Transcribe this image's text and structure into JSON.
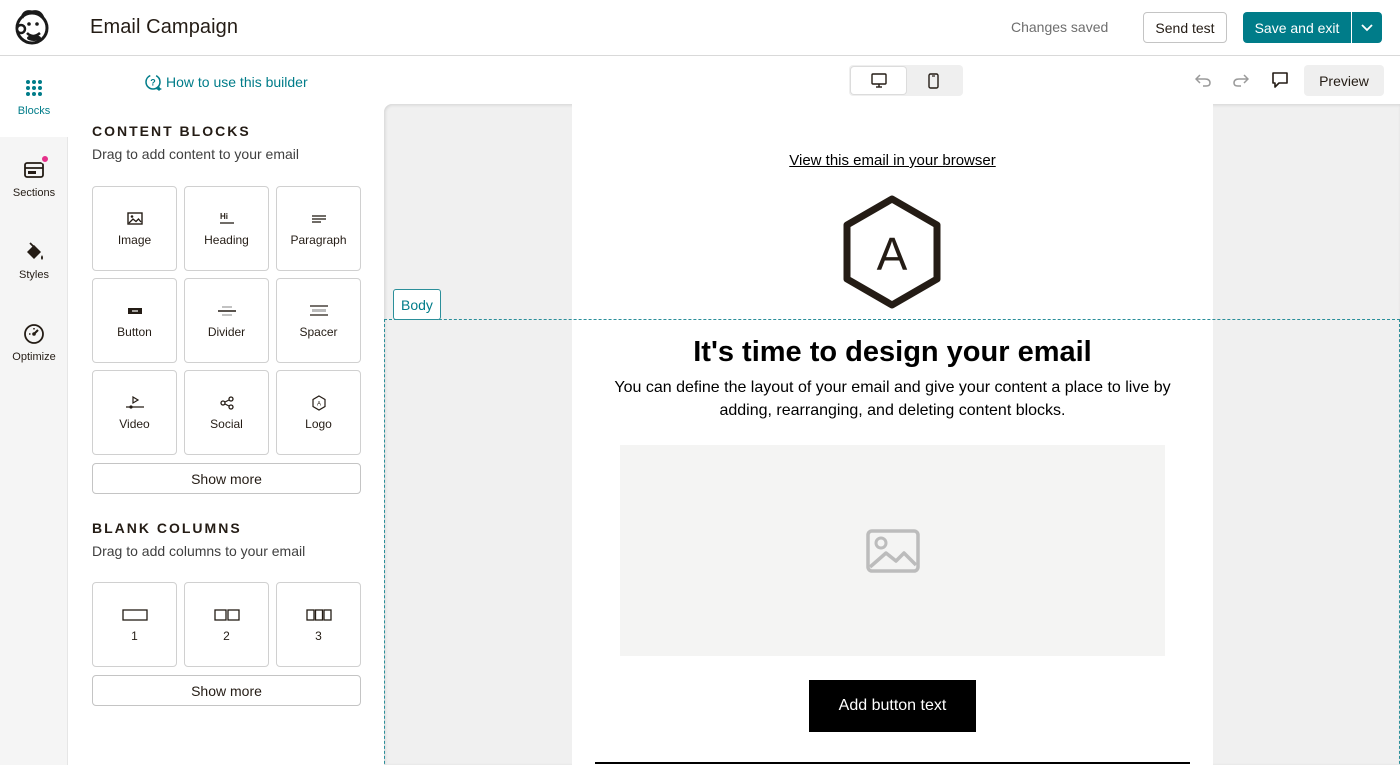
{
  "header": {
    "title": "Email Campaign",
    "status": "Changes saved",
    "send_test_label": "Send test",
    "save_exit_label": "Save and exit"
  },
  "rail": {
    "items": [
      {
        "label": "Blocks",
        "icon": "blocks-grid-icon",
        "active": true
      },
      {
        "label": "Sections",
        "icon": "sections-icon",
        "badge": true
      },
      {
        "label": "Styles",
        "icon": "paint-bucket-icon"
      },
      {
        "label": "Optimize",
        "icon": "gauge-icon"
      }
    ]
  },
  "panel": {
    "howto_label": "How to use this builder",
    "content_blocks": {
      "title": "CONTENT BLOCKS",
      "subtitle": "Drag to add content to your email",
      "items": [
        {
          "label": "Image",
          "icon": "image-icon"
        },
        {
          "label": "Heading",
          "icon": "heading-icon"
        },
        {
          "label": "Paragraph",
          "icon": "paragraph-icon"
        },
        {
          "label": "Button",
          "icon": "button-icon"
        },
        {
          "label": "Divider",
          "icon": "divider-icon"
        },
        {
          "label": "Spacer",
          "icon": "spacer-icon"
        },
        {
          "label": "Video",
          "icon": "video-icon"
        },
        {
          "label": "Social",
          "icon": "social-share-icon"
        },
        {
          "label": "Logo",
          "icon": "logo-hexagon-icon"
        }
      ],
      "show_more_label": "Show more"
    },
    "blank_columns": {
      "title": "BLANK COLUMNS",
      "subtitle": "Drag to add columns to your email",
      "items": [
        {
          "label": "1",
          "icon": "one-column-icon"
        },
        {
          "label": "2",
          "icon": "two-column-icon"
        },
        {
          "label": "3",
          "icon": "three-column-icon"
        }
      ],
      "show_more_label": "Show more"
    }
  },
  "toolbar": {
    "views": [
      "desktop-icon",
      "mobile-icon"
    ],
    "active_view": "desktop",
    "preview_label": "Preview"
  },
  "email": {
    "view_in_browser": "View this email in your browser",
    "logo_letter": "A",
    "body_tag": "Body",
    "heading": "It's time to design your email",
    "body_text": "You can define the layout of your email and give your content a place to live by adding, rearranging, and deleting content blocks.",
    "button_text": "Add button text"
  },
  "colors": {
    "accent": "#007c89",
    "badge": "#e5308a",
    "text": "#241c15",
    "canvas_bg": "#f0f0f0"
  }
}
